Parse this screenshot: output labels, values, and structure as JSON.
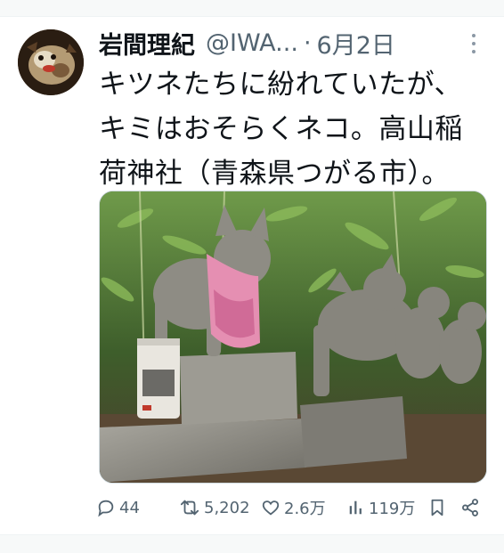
{
  "tweet": {
    "author_name": "岩間理紀",
    "handle": "@IWA...",
    "separator": "·",
    "date": "6月2日",
    "text_lines": [
      "キツネたちに紛れていたが、",
      "キミはおそらくネコ。高山稲",
      "荷神社（青森県つがる市）。"
    ]
  },
  "actions": {
    "reply": {
      "icon": "reply-icon",
      "count": "44"
    },
    "retweet": {
      "icon": "retweet-icon",
      "count": "5,202"
    },
    "like": {
      "icon": "heart-icon",
      "count": "2.6万"
    },
    "views": {
      "icon": "views-icon",
      "count": "119万"
    },
    "bookmark": {
      "icon": "bookmark-icon"
    },
    "share": {
      "icon": "share-icon"
    }
  },
  "colors": {
    "text_primary": "#0f1419",
    "text_secondary": "#536471",
    "border": "#cfd9de"
  }
}
